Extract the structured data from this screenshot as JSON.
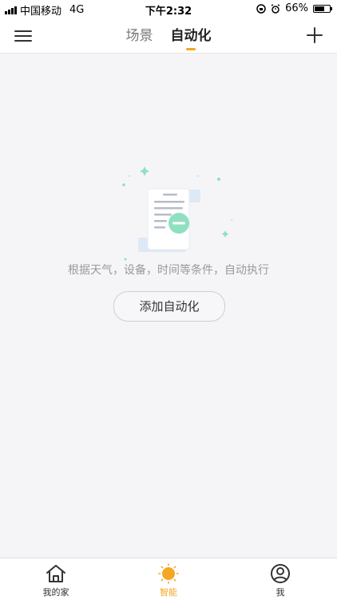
{
  "status_bar": {
    "carrier": "中国移动",
    "network": "4G",
    "time": "下午2:32",
    "battery": "66%",
    "battery_level": 0.66
  },
  "nav": {
    "tabs": [
      {
        "label": "场景",
        "active": false
      },
      {
        "label": "自动化",
        "active": true
      }
    ]
  },
  "empty_state": {
    "description": "根据天气，设备，时间等条件，自动执行",
    "button_label": "添加自动化"
  },
  "tab_bar": {
    "items": [
      {
        "label": "我的家",
        "icon": "home-icon",
        "active": false
      },
      {
        "label": "智能",
        "icon": "sun-icon",
        "active": true
      },
      {
        "label": "我",
        "icon": "user-icon",
        "active": false
      }
    ]
  },
  "colors": {
    "accent": "#f5a623",
    "background": "#f5f5f7",
    "illustration_green": "#8fe0c1"
  }
}
